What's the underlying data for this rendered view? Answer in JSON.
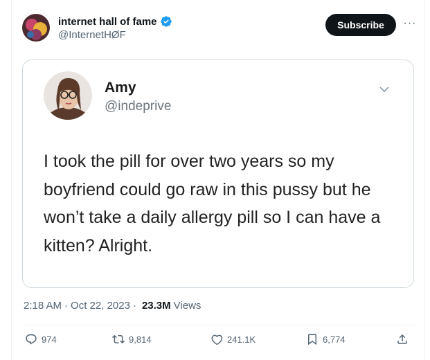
{
  "tweet": {
    "author": {
      "display_name": "internet hall of fame",
      "handle": "@InternetHØF",
      "verified_icon": "verified-badge-icon"
    },
    "subscribe_label": "Subscribe",
    "more_label": "···",
    "quoted_post": {
      "name": "Amy",
      "handle": "@indeprive",
      "text": "I took the pill for over two years so my boyfriend could go raw in this pussy but he won’t take a daily allergy pill so I can have a kitten? Alright."
    },
    "meta": {
      "time": "2:18 AM",
      "separator": "·",
      "date": "Oct 22, 2023",
      "views_count": "23.3M",
      "views_label": "Views"
    },
    "actions": {
      "replies": "974",
      "reposts": "9,814",
      "likes": "241.1K",
      "bookmarks": "6,774"
    }
  },
  "colors": {
    "accent_dark": "#0f1419",
    "secondary_text": "#536471",
    "verified_blue": "#1d9bf0",
    "border": "#cfd9de"
  }
}
